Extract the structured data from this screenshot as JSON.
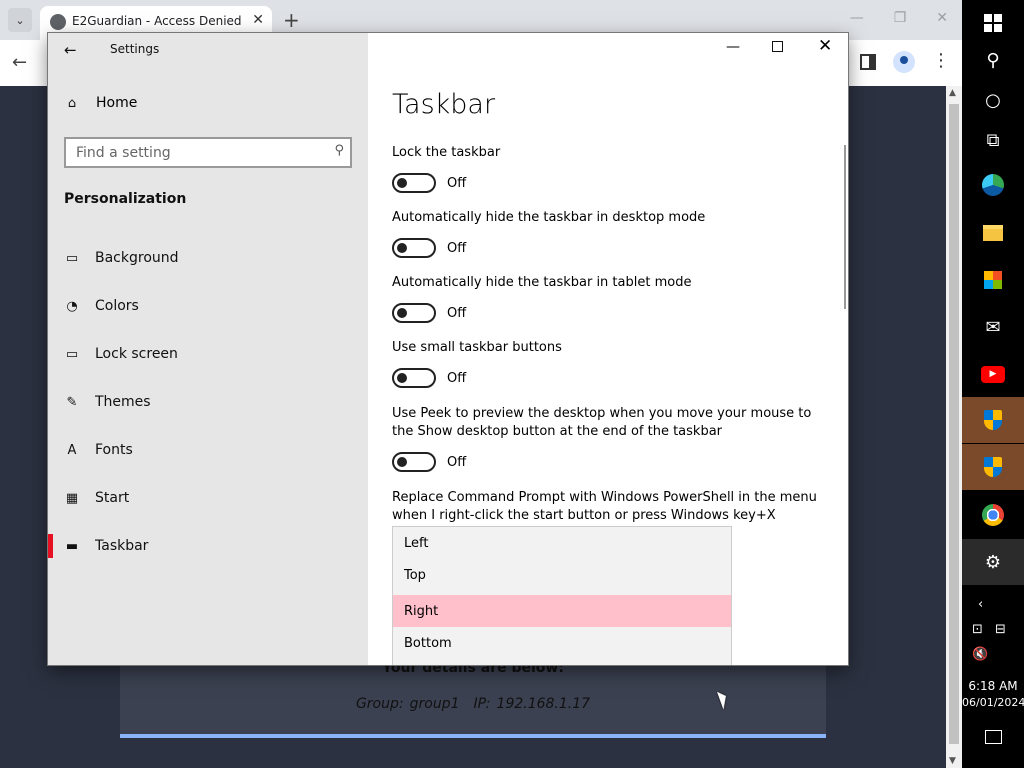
{
  "browser": {
    "tab_title": "E2Guardian - Access Denied",
    "tab_close": "✕",
    "new_tab": "+",
    "dropdown": "⌄",
    "back": "←",
    "menu": "⋮",
    "win_min": "—",
    "win_restore": "❐",
    "win_close": "✕"
  },
  "page": {
    "details_heading": "Your details are below:",
    "group_label": "Group:",
    "group_value": "group1",
    "ip_label": "IP:",
    "ip_value": "192.168.1.17"
  },
  "settings": {
    "window_title": "Settings",
    "back": "←",
    "home_label": "Home",
    "search_placeholder": "Find a setting",
    "section_title": "Personalization",
    "nav_items": [
      {
        "label": "Background",
        "icon": "picture-icon",
        "glyph": "▭"
      },
      {
        "label": "Colors",
        "icon": "palette-icon",
        "glyph": "◔"
      },
      {
        "label": "Lock screen",
        "icon": "lock-screen-icon",
        "glyph": "▭"
      },
      {
        "label": "Themes",
        "icon": "themes-icon",
        "glyph": "✎"
      },
      {
        "label": "Fonts",
        "icon": "fonts-icon",
        "glyph": "A"
      },
      {
        "label": "Start",
        "icon": "start-icon",
        "glyph": "▦"
      },
      {
        "label": "Taskbar",
        "icon": "taskbar-icon",
        "glyph": "▬"
      }
    ],
    "selected_nav": "Taskbar",
    "accent_color": "#e81123",
    "page_title": "Taskbar",
    "settings_items": [
      {
        "label": "Lock the taskbar",
        "state": "Off"
      },
      {
        "label": "Automatically hide the taskbar in desktop mode",
        "state": "Off"
      },
      {
        "label": "Automatically hide the taskbar in tablet mode",
        "state": "Off"
      },
      {
        "label": "Use small taskbar buttons",
        "state": "Off"
      },
      {
        "label": "Use Peek to preview the desktop when you move your mouse to the Show desktop button at the end of the taskbar",
        "state": "Off"
      },
      {
        "label": "Replace Command Prompt with Windows PowerShell in the menu when I right-click the start button or press Windows key+X"
      }
    ],
    "dropdown_options": [
      "Left",
      "Top",
      "Right",
      "Bottom"
    ],
    "dropdown_selected": "Right",
    "dropdown_highlight_color": "#ffc0cb",
    "min": "—",
    "close": "✕"
  },
  "taskbar": {
    "icons": [
      "windows-start-icon",
      "search-icon",
      "cortana-icon",
      "task-view-icon",
      "edge-icon",
      "file-explorer-icon",
      "store-icon",
      "mail-icon",
      "youtube-icon",
      "security-shield-icon",
      "security-shield-icon",
      "chrome-icon",
      "settings-gear-icon"
    ],
    "time": "6:18 AM",
    "date": "06/01/2024"
  }
}
